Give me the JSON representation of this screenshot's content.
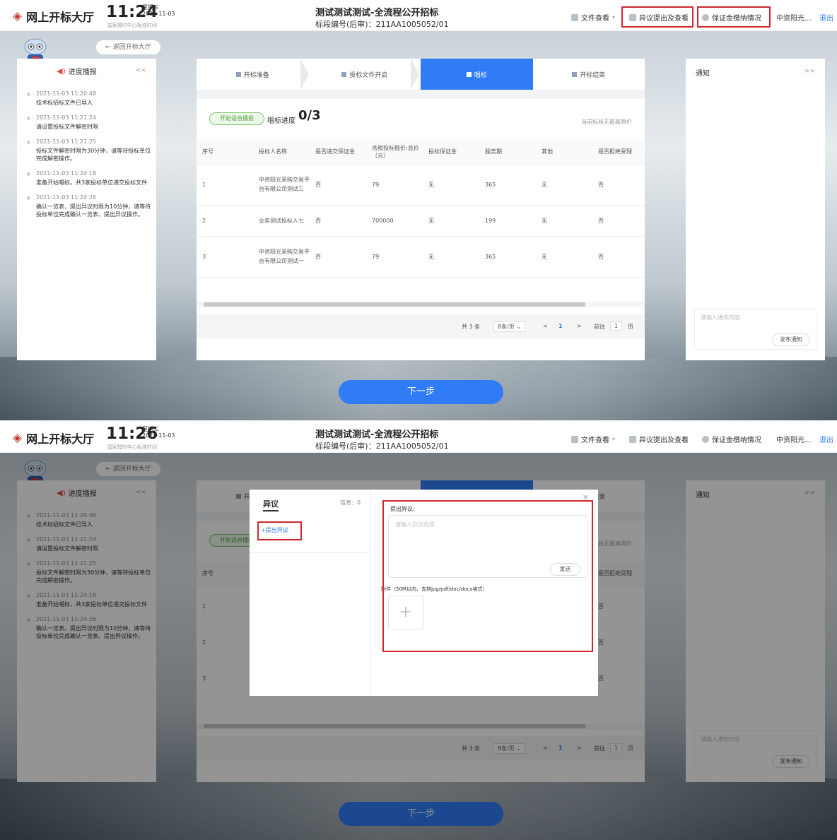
{
  "header": {
    "app_name": "网上开标大厅",
    "weekday": "星期三",
    "date": "2021-11-03",
    "timezone_note": "国家授时中心标准时间",
    "title": "测试测试测试-全流程公开招标",
    "section_label": "标段编号(后审)：211AA1005052/01",
    "nav_file_view": "文件查看",
    "nav_objection": "异议提出及查看",
    "nav_deposit": "保证金缴纳情况",
    "user": "中资阳光...",
    "logout": "退出"
  },
  "panes": [
    {
      "clock": "11:24"
    },
    {
      "clock": "11:26"
    }
  ],
  "back_button": "← 返回开标大厅",
  "left_panel": {
    "title": "进度播报",
    "collapse": "<<",
    "items": [
      {
        "time": "2021-11-03 11:20:48",
        "text": "技术标招标文件已导入"
      },
      {
        "time": "2021-11-03 11:21:24",
        "text": "请设置投标文件解密时限"
      },
      {
        "time": "2021-11-03 11:21:25",
        "text": "投标文件解密时限为30分钟，请等待投标单位完成解密操作。"
      },
      {
        "time": "2021-11-03 11:24:18",
        "text": "准备开始唱标，共3家投标单位递交投标文件"
      },
      {
        "time": "2021-11-03 11:24:26",
        "text": "确认一览表、提出异议时限为10分钟，请等待投标单位完成确认一览表、提出异议操作。"
      }
    ]
  },
  "steps": [
    "开标准备",
    "投标文件开启",
    "唱标",
    "开标结束"
  ],
  "active_step": 2,
  "main": {
    "voice_button": "开始语音播报",
    "progress_label": "唱标进度",
    "progress_value": "0/3",
    "price_note": "当前标段无最高限价",
    "table": {
      "headers": [
        "序号",
        "投标人名称",
        "是否递交保证金",
        "含税投标报价:总价（元）",
        "投标保证金",
        "服务期",
        "其他",
        "是否拒绝受理"
      ],
      "rows": [
        [
          "1",
          "中资阳光采购交易平台有限公司测试三",
          "否",
          "79",
          "无",
          "365",
          "无",
          "否"
        ],
        [
          "2",
          "业务测试投标人七",
          "否",
          "700000",
          "无",
          "199",
          "无",
          "否"
        ],
        [
          "3",
          "中资阳光采购交易平台有限公司测试一",
          "否",
          "79",
          "无",
          "365",
          "无",
          "否"
        ]
      ]
    },
    "pagination": {
      "total": "共 3 条",
      "page_size": "8条/页",
      "prev": "<",
      "page": "1",
      "next": ">",
      "goto_label": "前往",
      "goto_value": "1",
      "page_suffix": "页"
    }
  },
  "right_panel": {
    "title": "通知",
    "expand": ">>",
    "placeholder": "请输入通知内容",
    "publish": "发布通知"
  },
  "next_button": "下一步",
  "modal": {
    "title": "异议",
    "info": "信息：0",
    "add": "+提出异议",
    "close": "×",
    "label": "提出异议:",
    "placeholder": "请输入异议内容",
    "send": "发送",
    "attachment_note": "附件（50M以内，支持jpg/pdf/doc/docx格式）",
    "upload": "+"
  },
  "colors": {
    "accent": "#2f7cf6",
    "highlight_box": "#d0282e",
    "voice_green": "#56a843"
  }
}
